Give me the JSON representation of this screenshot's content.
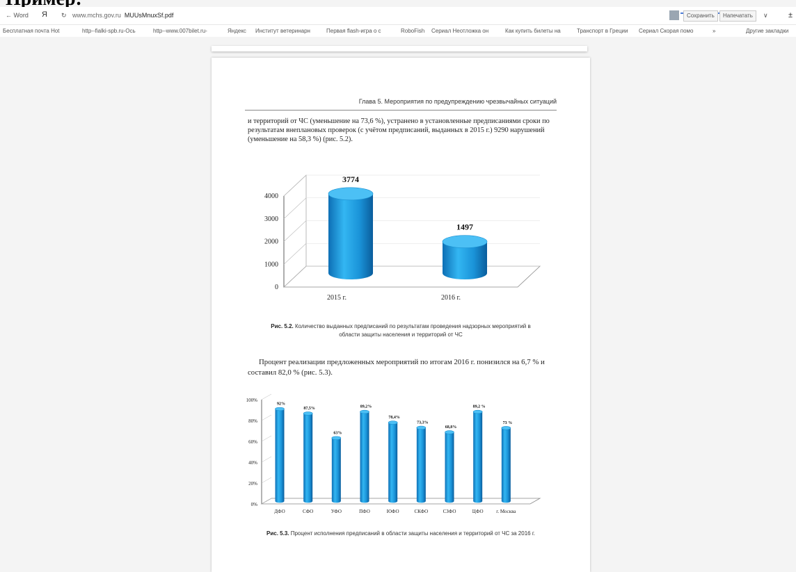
{
  "cutoff_heading": "Пример:",
  "browser": {
    "back_label": "← Word",
    "yandex_logo": "Я",
    "reload_icon": "reload-icon",
    "url_domain": "www.mchs.gov.ru",
    "url_file": "MUUsMnuxSf.pdf",
    "save_label": "Сохранить",
    "print_label": "Напечатать",
    "menu_chevron": "∨",
    "download_glyph": "±"
  },
  "bookmarks": [
    "Бесплатная почта Hot",
    "http--fialki-spb.ru-Ось",
    "http--www.007bilet.ru-",
    "Яндекс",
    "Институт ветеринарн",
    "Первая flash-игра о с",
    "RoboFish",
    "Сериал Неотложка он",
    "Как купить билеты на",
    "Транспорт в Греции",
    "Сериал Скорая помо",
    "»",
    "Другие закладки"
  ],
  "document": {
    "chapter_header": "Глава 5. Мероприятия по предупреждению чрезвычайных ситуаций",
    "paragraph1": "и территорий от ЧС (уменьшение на 73,6 %), устранено в установленные предписаниями сроки по результатам внеплановых проверок (с учётом предписаний, выданных в 2015 г.) 9290 нарушений (уменьшение на 58,3 %) (рис. 5.2).",
    "caption1_label": "Рис. 5.2.",
    "caption1_text": "Количество выданных предписаний по результатам проведения надзорных мероприятий в области защиты населения и территорий от ЧС",
    "paragraph2": "Процент реализации предложенных мероприятий по итогам 2016 г. понизился на 6,7 % и составил 82,0 % (рис. 5.3).",
    "caption2_label": "Рис. 5.3.",
    "caption2_text": "Процент исполнения предписаний в области защиты населения и территорий от ЧС за 2016 г."
  },
  "chart_data": [
    {
      "type": "bar",
      "categories": [
        "2015 г.",
        "2016 г."
      ],
      "values": [
        3774,
        1497
      ],
      "value_labels": [
        "3774",
        "1497"
      ],
      "ylim": [
        0,
        4000
      ],
      "yticks": [
        "0",
        "1000",
        "2000",
        "3000",
        "4000"
      ],
      "three_d": true,
      "color": "#1fa2e4"
    },
    {
      "type": "bar",
      "categories": [
        "ДФО",
        "СФО",
        "УФО",
        "ПФО",
        "ЮФО",
        "СКФО",
        "СЗФО",
        "ЦФО",
        "г. Москва"
      ],
      "values": [
        92,
        87.5,
        63,
        89.2,
        78.4,
        73.3,
        68.8,
        89.2,
        73
      ],
      "value_labels": [
        "92%",
        "87,5%",
        "63%",
        "89,2%",
        "78,4%",
        "73,3%",
        "68,8%",
        "89,2 %",
        "73 %"
      ],
      "ylim": [
        0,
        100
      ],
      "yticks": [
        "0%",
        "20%",
        "40%",
        "60%",
        "80%",
        "100%"
      ],
      "three_d": true,
      "color": "#1fa2e4"
    }
  ]
}
